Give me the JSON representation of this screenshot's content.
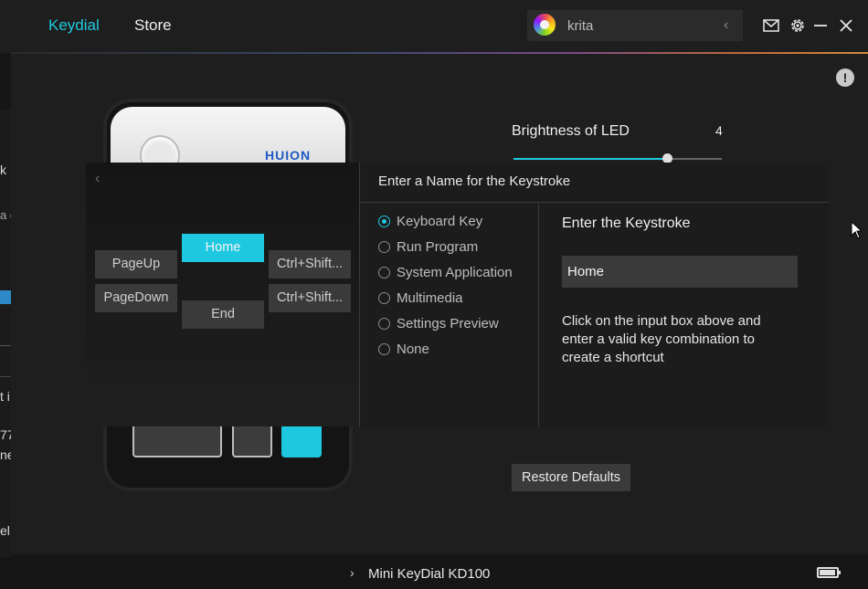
{
  "tabs": [
    {
      "label": "Keydial",
      "active": true
    },
    {
      "label": "Store",
      "active": false
    }
  ],
  "app_selector": {
    "name": "krita",
    "icon": "krita-logo-icon"
  },
  "window_controls": [
    "mail-icon",
    "gear-icon",
    "minimize-icon",
    "close-icon"
  ],
  "left_edge_fragments": [
    "k",
    "a c",
    "t i",
    "77",
    "ne",
    "el"
  ],
  "device": {
    "brand_logo": "HUION",
    "model": "Mini KeyDial KD100"
  },
  "led": {
    "label": "Brightness of LED",
    "value": "4",
    "level_fraction": 0.75
  },
  "keystroke_dialog": {
    "title": "Enter a Name for the Keystroke",
    "keys": {
      "pageup": "PageUp",
      "home": "Home",
      "ctrl_shift_1": "Ctrl+Shift...",
      "pagedown": "PageDown",
      "end": "End",
      "ctrl_shift_2": "Ctrl+Shift..."
    },
    "options": [
      {
        "label": "Keyboard Key",
        "checked": true
      },
      {
        "label": "Run Program",
        "checked": false
      },
      {
        "label": "System Application",
        "checked": false
      },
      {
        "label": "Multimedia",
        "checked": false
      },
      {
        "label": "Settings Preview",
        "checked": false
      },
      {
        "label": "None",
        "checked": false
      }
    ],
    "input_label": "Enter the Keystroke",
    "input_value": "Home",
    "help": "Click on the input box above and enter a valid key combination to create a shortcut"
  },
  "restore_defaults": "Restore Defaults",
  "colors": {
    "accent": "#1ec8e0",
    "background": "#1e1e1e",
    "panel": "#3a3a3a"
  }
}
